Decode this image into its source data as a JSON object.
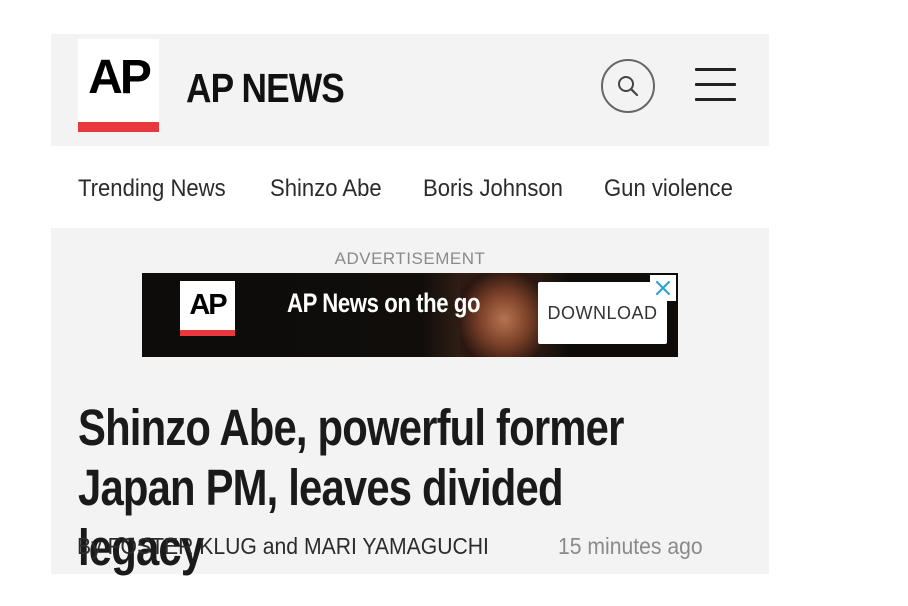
{
  "header": {
    "logo_text": "AP",
    "brand_title": "AP NEWS",
    "search_icon": "search-icon",
    "menu_icon": "hamburger-menu-icon",
    "logo_bar_color": "#e8383d"
  },
  "nav": {
    "items": [
      {
        "label": "Trending News"
      },
      {
        "label": "Shinzo Abe"
      },
      {
        "label": "Boris Johnson"
      },
      {
        "label": "Gun violence"
      }
    ]
  },
  "ad": {
    "label": "ADVERTISEMENT",
    "logo_text": "AP",
    "tagline": "AP News on the go",
    "cta": "DOWNLOAD",
    "close_icon": "close-icon",
    "close_color": "#2fa3d4"
  },
  "article": {
    "headline": "Shinzo Abe, powerful former Japan PM, leaves divided legacy",
    "byline": "By FOSTER KLUG and MARI YAMAGUCHI",
    "timestamp": "15 minutes ago"
  }
}
